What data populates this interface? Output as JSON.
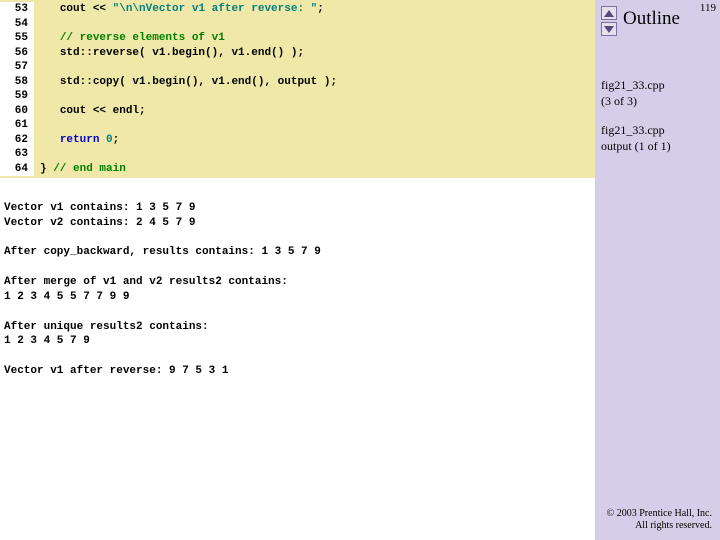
{
  "page_number": "119",
  "sidebar": {
    "outline_label": "Outline",
    "links": [
      {
        "label": "fig21_33.cpp",
        "sub": "(3 of 3)"
      },
      {
        "label": "fig21_33.cpp",
        "sub": "output (1 of 1)"
      }
    ],
    "copyright_line1": "© 2003 Prentice Hall, Inc.",
    "copyright_line2": "All rights reserved."
  },
  "code": {
    "lines": [
      {
        "n": "53",
        "pre": "   ",
        "segs": [
          {
            "t": "cout << ",
            "c": ""
          },
          {
            "t": "\"\\n\\nVector v1 after reverse: \"",
            "c": "str"
          },
          {
            "t": ";",
            "c": ""
          }
        ]
      },
      {
        "n": "54",
        "pre": "",
        "segs": []
      },
      {
        "n": "55",
        "pre": "   ",
        "segs": [
          {
            "t": "// reverse elements of v1",
            "c": "cm"
          }
        ]
      },
      {
        "n": "56",
        "pre": "   ",
        "segs": [
          {
            "t": "std::reverse( v1.begin(), v1.end() );",
            "c": ""
          }
        ]
      },
      {
        "n": "57",
        "pre": "",
        "segs": []
      },
      {
        "n": "58",
        "pre": "   ",
        "segs": [
          {
            "t": "std::copy( v1.begin(), v1.end(), output );",
            "c": ""
          }
        ]
      },
      {
        "n": "59",
        "pre": "",
        "segs": []
      },
      {
        "n": "60",
        "pre": "   ",
        "segs": [
          {
            "t": "cout << endl;",
            "c": ""
          }
        ]
      },
      {
        "n": "61",
        "pre": "",
        "segs": []
      },
      {
        "n": "62",
        "pre": "   ",
        "segs": [
          {
            "t": "return",
            "c": "kw"
          },
          {
            "t": " ",
            "c": ""
          },
          {
            "t": "0",
            "c": "num"
          },
          {
            "t": ";",
            "c": ""
          }
        ]
      },
      {
        "n": "63",
        "pre": "",
        "segs": []
      },
      {
        "n": "64",
        "pre": "",
        "segs": [
          {
            "t": "} ",
            "c": ""
          },
          {
            "t": "// end main",
            "c": "cm"
          }
        ]
      }
    ]
  },
  "output": {
    "l1": "Vector v1 contains: 1 3 5 7 9",
    "l2": "Vector v2 contains: 2 4 5 7 9",
    "l3": "After copy_backward, results contains: 1 3 5 7 9",
    "l4": "After merge of v1 and v2 results2 contains:",
    "l5": "1 2 3 4 5 5 7 7 9 9",
    "l6": "After unique results2 contains:",
    "l7": "1 2 3 4 5 7 9",
    "l8": "Vector v1 after reverse: 9 7 5 3 1"
  }
}
